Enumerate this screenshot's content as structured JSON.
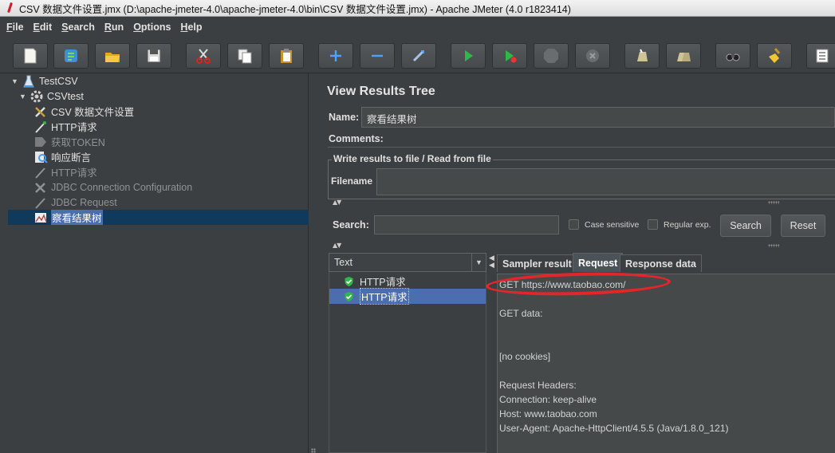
{
  "window": {
    "title": "CSV 数据文件设置.jmx (D:\\apache-jmeter-4.0\\apache-jmeter-4.0\\bin\\CSV 数据文件设置.jmx) - Apache JMeter (4.0 r1823414)"
  },
  "menu": {
    "items": [
      {
        "first": "F",
        "rest": "ile"
      },
      {
        "first": "E",
        "rest": "dit"
      },
      {
        "first": "S",
        "rest": "earch"
      },
      {
        "first": "R",
        "rest": "un"
      },
      {
        "first": "O",
        "rest": "ptions"
      },
      {
        "first": "H",
        "rest": "elp"
      }
    ]
  },
  "toolbar": {
    "icons": [
      "new-icon",
      "templates-icon",
      "open-icon",
      "save-icon",
      "cut-icon",
      "copy-icon",
      "paste-icon",
      "expand-icon",
      "collapse-icon",
      "toggle-icon",
      "start-icon",
      "start-no-pause-icon",
      "stop-icon",
      "shutdown-icon",
      "clear-icon",
      "clear-all-icon",
      "search-icon",
      "reset-search-icon",
      "function-helper-icon"
    ]
  },
  "tree": {
    "items": [
      {
        "label": "TestCSV",
        "icon": "test-plan-icon",
        "disabled": false
      },
      {
        "label": "CSVtest",
        "icon": "thread-group-icon",
        "disabled": false
      },
      {
        "label": "CSV 数据文件设置",
        "icon": "config-element-icon",
        "disabled": false
      },
      {
        "label": "HTTP请求",
        "icon": "sampler-icon",
        "disabled": false
      },
      {
        "label": "获取TOKEN",
        "icon": "extractor-icon",
        "disabled": true
      },
      {
        "label": "响应断言",
        "icon": "assertion-icon",
        "disabled": false
      },
      {
        "label": "HTTP请求",
        "icon": "sampler-icon",
        "disabled": true
      },
      {
        "label": "JDBC Connection Configuration",
        "icon": "config-element-icon",
        "disabled": true
      },
      {
        "label": "JDBC Request",
        "icon": "sampler-icon",
        "disabled": true
      },
      {
        "label": "察看结果树",
        "icon": "listener-icon",
        "disabled": false,
        "selected": true
      }
    ]
  },
  "panel": {
    "title": "View Results Tree",
    "name_label": "Name:",
    "name_value": "察看结果树",
    "comments_label": "Comments:",
    "write_group_title": "Write results to file / Read from file",
    "filename_label": "Filename"
  },
  "search": {
    "label": "Search:",
    "value": "",
    "case_sensitive_label": "Case sensitive",
    "regex_label": "Regular exp.",
    "search_button": "Search",
    "reset_button": "Reset"
  },
  "results": {
    "renderer": "Text",
    "items": [
      {
        "label": "HTTP请求",
        "status": "success",
        "selected": false
      },
      {
        "label": "HTTP请求",
        "status": "success",
        "selected": true
      }
    ]
  },
  "tabs": [
    {
      "label": "Sampler result",
      "active": false
    },
    {
      "label": "Request",
      "active": true
    },
    {
      "label": "Response data",
      "active": false
    }
  ],
  "request": {
    "lines": [
      "GET https://www.taobao.com/",
      "",
      "GET data:",
      "",
      "",
      "[no cookies]",
      "",
      "Request Headers:",
      "Connection: keep-alive",
      "Host: www.taobao.com",
      "User-Agent: Apache-HttpClient/4.5.5 (Java/1.8.0_121)"
    ]
  },
  "colors": {
    "background": "#3c3f41",
    "selection": "#4b6eaf",
    "highlight_ellipse": "#e3262b",
    "success": "#2fb84a"
  }
}
